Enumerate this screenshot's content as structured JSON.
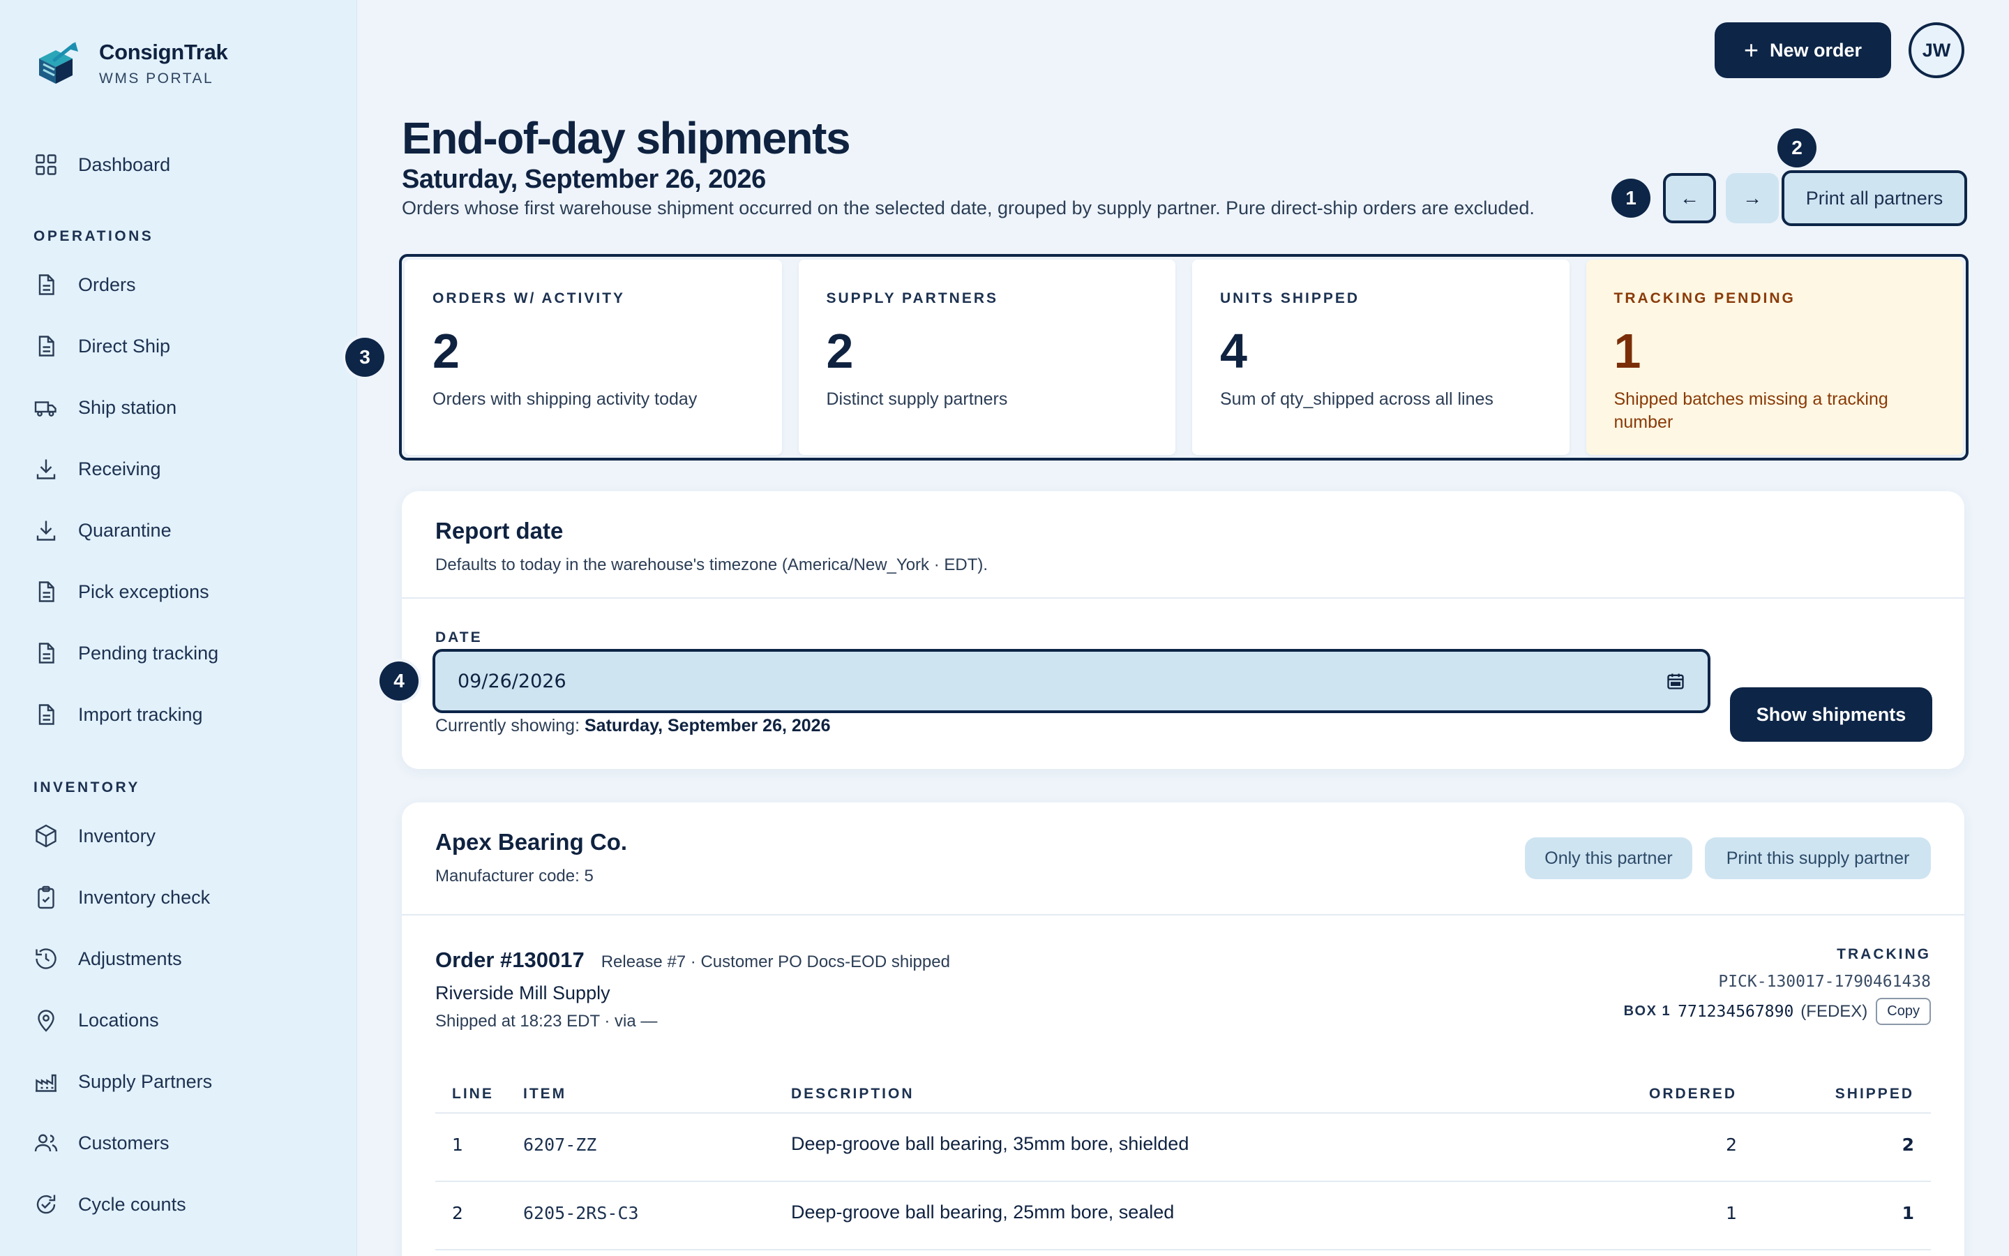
{
  "brand": {
    "name": "ConsignTrak",
    "subtitle": "WMS PORTAL"
  },
  "sidebar": {
    "top_items": [
      {
        "label": "Dashboard",
        "icon": "grid-icon"
      }
    ],
    "sections": [
      {
        "title": "OPERATIONS",
        "items": [
          {
            "label": "Orders",
            "icon": "document-icon"
          },
          {
            "label": "Direct Ship",
            "icon": "document-icon"
          },
          {
            "label": "Ship station",
            "icon": "truck-icon"
          },
          {
            "label": "Receiving",
            "icon": "download-icon"
          },
          {
            "label": "Quarantine",
            "icon": "download-icon"
          },
          {
            "label": "Pick exceptions",
            "icon": "document-icon"
          },
          {
            "label": "Pending tracking",
            "icon": "document-icon"
          },
          {
            "label": "Import tracking",
            "icon": "document-icon"
          }
        ]
      },
      {
        "title": "INVENTORY",
        "items": [
          {
            "label": "Inventory",
            "icon": "box-icon"
          },
          {
            "label": "Inventory check",
            "icon": "clipboard-check-icon"
          },
          {
            "label": "Adjustments",
            "icon": "history-icon"
          },
          {
            "label": "Locations",
            "icon": "map-pin-icon"
          },
          {
            "label": "Supply Partners",
            "icon": "factory-icon"
          },
          {
            "label": "Customers",
            "icon": "users-icon"
          },
          {
            "label": "Cycle counts",
            "icon": "refresh-check-icon"
          }
        ]
      }
    ]
  },
  "topbar": {
    "new_order_label": "New order",
    "avatar_initials": "JW"
  },
  "header": {
    "title": "End-of-day shipments",
    "date": "Saturday, September 26, 2026",
    "description": "Orders whose first warehouse shipment occurred on the selected date, grouped by supply partner. Pure direct-ship orders are excluded.",
    "prev_label": "←",
    "next_label": "→",
    "print_all_label": "Print all partners"
  },
  "callouts": [
    "1",
    "2",
    "3",
    "4"
  ],
  "stats": [
    {
      "label": "ORDERS W/ ACTIVITY",
      "value": "2",
      "caption": "Orders with shipping activity today"
    },
    {
      "label": "SUPPLY PARTNERS",
      "value": "2",
      "caption": "Distinct supply partners"
    },
    {
      "label": "UNITS SHIPPED",
      "value": "4",
      "caption": "Sum of qty_shipped across all lines"
    },
    {
      "label": "TRACKING PENDING",
      "value": "1",
      "caption": "Shipped batches missing a tracking number",
      "tone": "warning"
    }
  ],
  "report_date": {
    "title": "Report date",
    "subtitle": "Defaults to today in the warehouse's timezone (America/New_York · EDT).",
    "field_label": "DATE",
    "value": "09/26/2026",
    "currently_prefix": "Currently showing:",
    "currently_value": "Saturday, September 26, 2026",
    "submit_label": "Show shipments"
  },
  "partner": {
    "name": "Apex Bearing Co.",
    "code": "Manufacturer code: 5",
    "only_label": "Only this partner",
    "print_label": "Print this supply partner",
    "order": {
      "number": "Order #130017",
      "meta": "Release #7 · Customer PO Docs-EOD shipped",
      "customer": "Riverside Mill Supply",
      "shipped": "Shipped at 18:23 EDT · via —",
      "tracking_label": "TRACKING",
      "pick_id": "PICK-130017-1790461438",
      "box_label": "BOX 1",
      "box_tracking": "771234567890",
      "carrier": "(FEDEX)",
      "copy_label": "Copy"
    },
    "table": {
      "columns": [
        "LINE",
        "ITEM",
        "DESCRIPTION",
        "ORDERED",
        "SHIPPED"
      ],
      "rows": [
        {
          "line": "1",
          "item": "6207-ZZ",
          "description": "Deep-groove ball bearing, 35mm bore, shielded",
          "ordered": "2",
          "shipped": "2"
        },
        {
          "line": "2",
          "item": "6205-2RS-C3",
          "description": "Deep-groove ball bearing, 25mm bore, sealed",
          "ordered": "1",
          "shipped": "1"
        }
      ]
    }
  }
}
